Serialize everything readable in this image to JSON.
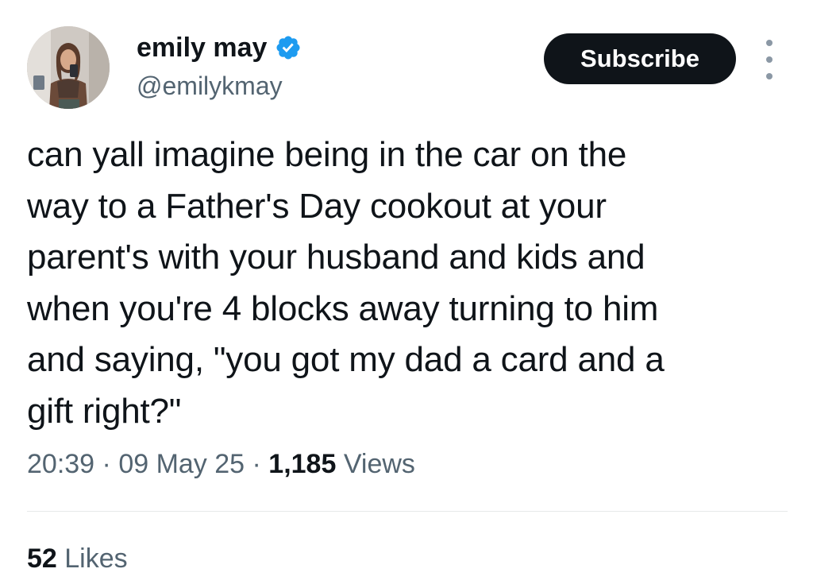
{
  "author": {
    "display_name": "emily may",
    "handle": "@emilykmay",
    "verified": true,
    "verified_color": "#1d9bf0"
  },
  "actions": {
    "subscribe_label": "Subscribe",
    "more_icon": "more-vertical-icon"
  },
  "tweet": {
    "text": "can yall imagine being in the car on the\nway to a Father's Day cookout at your\nparent's with your husband and kids and\nwhen you're 4 blocks away turning to him\nand saying, \"you got my dad a card and a\ngift right?\""
  },
  "meta": {
    "time": "20:39",
    "separator": " · ",
    "date": "09 May 25",
    "views_count": "1,185",
    "views_label": " Views"
  },
  "engagement": {
    "likes_count": "52",
    "likes_label": " Likes"
  },
  "colors": {
    "text_primary": "#0f1419",
    "text_secondary": "#536471",
    "button_bg": "#0f1419"
  }
}
